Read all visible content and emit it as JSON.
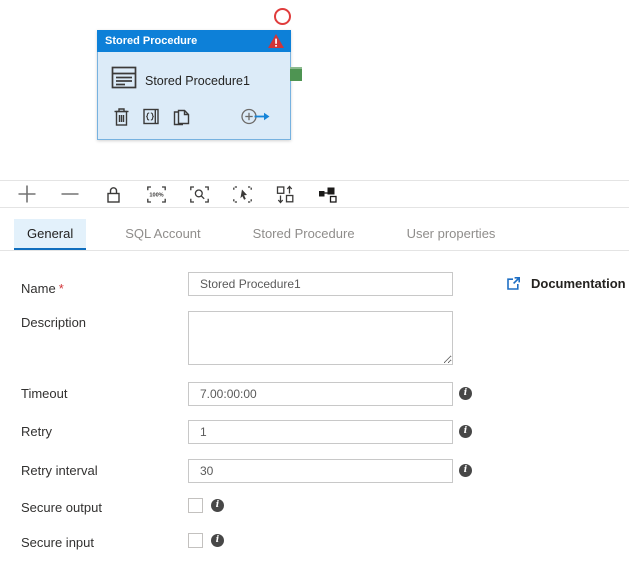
{
  "canvas": {
    "node": {
      "type_label": "Stored Procedure",
      "name": "Stored Procedure1",
      "colors": {
        "header": "#0d80d8",
        "body": "#dcebf8",
        "warning": "#d13438",
        "output_port": "#4e9452",
        "marker_circle": "#e03c3c"
      },
      "action_icons": [
        "delete-icon",
        "code-icon",
        "clone-icon",
        "add-output-icon"
      ]
    }
  },
  "toolbar": {
    "icons": [
      {
        "name": "zoom-in-icon"
      },
      {
        "name": "zoom-out-icon"
      },
      {
        "name": "lock-icon"
      },
      {
        "name": "zoom-100-icon",
        "label": "100%"
      },
      {
        "name": "zoom-fit-icon"
      },
      {
        "name": "multi-select-icon"
      },
      {
        "name": "auto-align-icon"
      },
      {
        "name": "minimap-icon"
      }
    ]
  },
  "tabs": [
    {
      "label": "General",
      "active": true
    },
    {
      "label": "SQL Account",
      "active": false
    },
    {
      "label": "Stored Procedure",
      "active": false
    },
    {
      "label": "User properties",
      "active": false
    }
  ],
  "form": {
    "name": {
      "label": "Name",
      "required_marker": "*",
      "value": "Stored Procedure1"
    },
    "documentation": {
      "label": "Documentation",
      "icon": "external-link-icon"
    },
    "description": {
      "label": "Description",
      "value": ""
    },
    "timeout": {
      "label": "Timeout",
      "value": "7.00:00:00"
    },
    "retry": {
      "label": "Retry",
      "value": "1"
    },
    "retry_interval": {
      "label": "Retry interval",
      "value": "30"
    },
    "secure_output": {
      "label": "Secure output",
      "checked": false
    },
    "secure_input": {
      "label": "Secure input",
      "checked": false
    },
    "info_glyph": "i"
  },
  "colors": {
    "accent": "#106ebe",
    "tab_active_bg": "#e3f1fb"
  }
}
